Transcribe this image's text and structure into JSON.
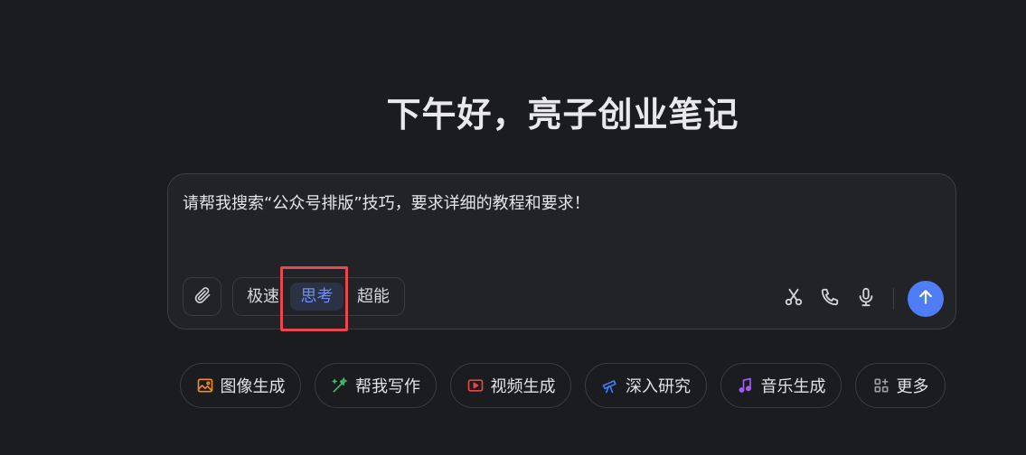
{
  "greeting": "下午好，亮子创业笔记",
  "composer": {
    "prompt_text": "请帮我搜索“公众号排版”技巧，要求详细的教程和要求！",
    "modes": [
      {
        "label": "极速",
        "selected": false
      },
      {
        "label": "思考",
        "selected": true
      },
      {
        "label": "超能",
        "selected": false
      }
    ],
    "tools": [
      "paperclip-icon",
      "scissors-icon",
      "phone-icon",
      "microphone-icon",
      "arrow-up-icon"
    ]
  },
  "quick_actions": [
    {
      "label": "图像生成",
      "icon": "image-icon",
      "color": "#f08a24"
    },
    {
      "label": "帮我写作",
      "icon": "pen-icon",
      "color": "#3fb96a"
    },
    {
      "label": "视频生成",
      "icon": "video-icon",
      "color": "#e84545"
    },
    {
      "label": "深入研究",
      "icon": "telescope-icon",
      "color": "#3d7cf5"
    },
    {
      "label": "音乐生成",
      "icon": "music-icon",
      "color": "#a35ef0"
    },
    {
      "label": "更多",
      "icon": "grid-icon",
      "color": "#9a9ca3"
    }
  ],
  "colors": {
    "background": "#1b1c1f",
    "composer_bg": "#222327",
    "accent": "#4f7cf7",
    "selected_mode_text": "#6c8cff",
    "highlight": "#e8484d"
  }
}
